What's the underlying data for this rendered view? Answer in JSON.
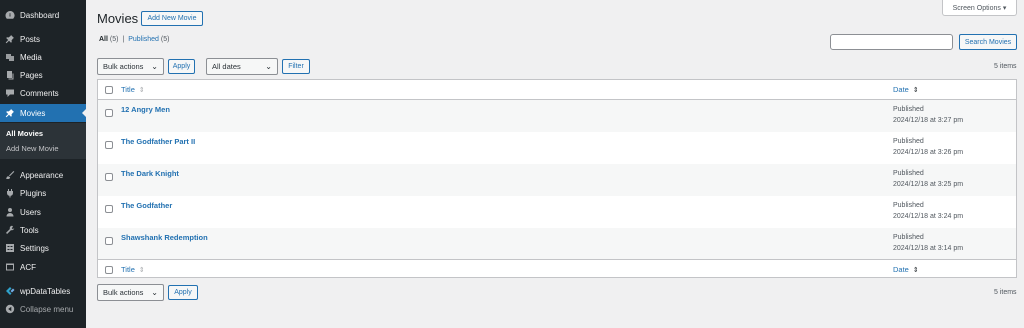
{
  "sidebar": {
    "items": [
      {
        "label": "Dashboard",
        "icon": "dashboard-icon"
      },
      {
        "label": "Posts",
        "icon": "pin-icon"
      },
      {
        "label": "Media",
        "icon": "media-icon"
      },
      {
        "label": "Pages",
        "icon": "pages-icon"
      },
      {
        "label": "Comments",
        "icon": "comments-icon"
      },
      {
        "label": "Movies",
        "icon": "pin-icon"
      },
      {
        "label": "Appearance",
        "icon": "brush-icon"
      },
      {
        "label": "Plugins",
        "icon": "plug-icon"
      },
      {
        "label": "Users",
        "icon": "user-icon"
      },
      {
        "label": "Tools",
        "icon": "wrench-icon"
      },
      {
        "label": "Settings",
        "icon": "settings-icon"
      },
      {
        "label": "ACF",
        "icon": "acf-icon"
      },
      {
        "label": "wpDataTables",
        "icon": "wpdatatables-icon"
      },
      {
        "label": "Collapse menu",
        "icon": "collapse-icon"
      }
    ],
    "submenu": [
      "All Movies",
      "Add New Movie"
    ]
  },
  "header": {
    "title": "Movies",
    "add_new_label": "Add New Movie",
    "screen_options_label": "Screen Options ▾"
  },
  "filters": {
    "all_label": "All",
    "all_count": "(5)",
    "separator": "|",
    "published_label": "Published",
    "published_count": "(5)"
  },
  "search": {
    "value": "",
    "button_label": "Search Movies"
  },
  "tablenav_top": {
    "bulk_actions": "Bulk actions",
    "apply_label": "Apply",
    "dates": "All dates",
    "filter_label": "Filter",
    "items_count": "5 items"
  },
  "table": {
    "col_title": "Title",
    "col_date": "Date",
    "rows": [
      {
        "title": "12 Angry Men",
        "status": "Published",
        "datetime": "2024/12/18 at 3:27 pm"
      },
      {
        "title": "The Godfather Part II",
        "status": "Published",
        "datetime": "2024/12/18 at 3:26 pm"
      },
      {
        "title": "The Dark Knight",
        "status": "Published",
        "datetime": "2024/12/18 at 3:25 pm"
      },
      {
        "title": "The Godfather",
        "status": "Published",
        "datetime": "2024/12/18 at 3:24 pm"
      },
      {
        "title": "Shawshank Redemption",
        "status": "Published",
        "datetime": "2024/12/18 at 3:14 pm"
      }
    ]
  },
  "tablenav_bottom": {
    "bulk_actions": "Bulk actions",
    "apply_label": "Apply",
    "items_count": "5 items"
  }
}
